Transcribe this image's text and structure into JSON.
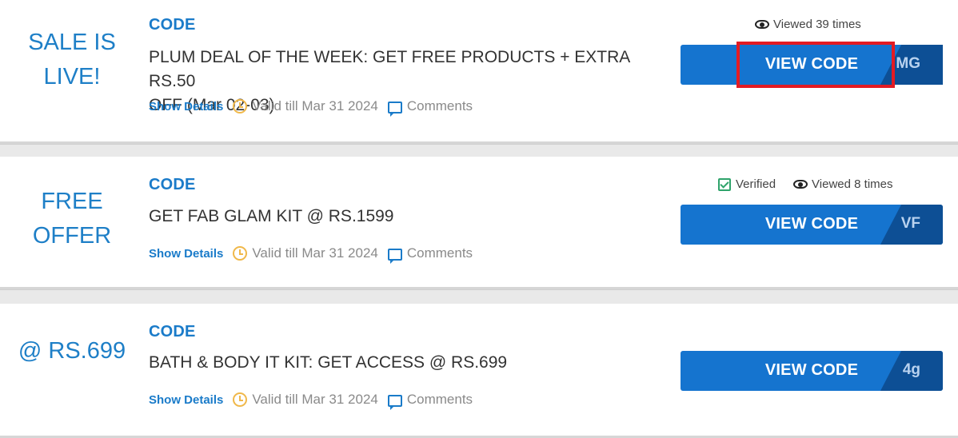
{
  "coupons": [
    {
      "badge_line1": "SALE IS",
      "badge_line2": "LIVE!",
      "type": "CODE",
      "title_line1": "PLUM DEAL OF THE WEEK: GET FREE PRODUCTS + EXTRA RS.50",
      "title_line2": "OFF (Mar 02-03)",
      "show_details": "Show Details",
      "valid": "Valid till Mar 31 2024",
      "comments": "Comments",
      "viewed": "Viewed 39 times",
      "button_label": "VIEW CODE",
      "code_fragment": "MG"
    },
    {
      "badge_line1": "FREE",
      "badge_line2": "OFFER",
      "type": "CODE",
      "title_line1": "GET FAB GLAM KIT @ RS.1599",
      "show_details": "Show Details",
      "valid": "Valid till Mar 31 2024",
      "comments": "Comments",
      "verified": "Verified",
      "viewed": "Viewed 8 times",
      "button_label": "VIEW CODE",
      "code_fragment": "VF"
    },
    {
      "badge_line1": "@ RS.699",
      "type": "CODE",
      "title_line1": "BATH & BODY IT KIT: GET ACCESS @ RS.699",
      "show_details": "Show Details",
      "valid": "Valid till Mar 31 2024",
      "comments": "Comments",
      "button_label": "VIEW CODE",
      "code_fragment": "4g"
    }
  ],
  "colors": {
    "accent": "#1574cf",
    "badge_text": "#1e7fc7",
    "highlight": "#e31b23",
    "verified": "#2fa36b",
    "clock": "#f0b84a"
  },
  "icons": [
    "eye-icon",
    "verified-icon",
    "clock-icon",
    "comment-icon"
  ]
}
